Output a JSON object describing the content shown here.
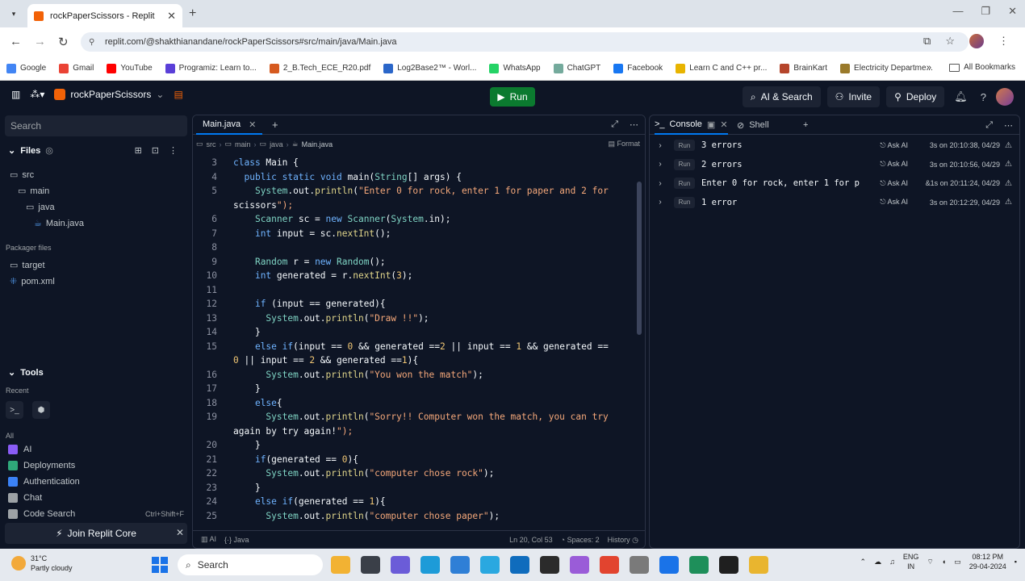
{
  "browser": {
    "tab_title": "rockPaperScissors - Replit",
    "url": "replit.com/@shakthianandane/rockPaperScissors#src/main/java/Main.java",
    "bookmarks": [
      {
        "label": "Google",
        "color": "#4285f4"
      },
      {
        "label": "Gmail",
        "color": "#ea4335"
      },
      {
        "label": "YouTube",
        "color": "#ff0000"
      },
      {
        "label": "Programiz: Learn to...",
        "color": "#5a3fd8"
      },
      {
        "label": "2_B.Tech_ECE_R20.pdf",
        "color": "#d65a1f"
      },
      {
        "label": "Log2Base2™ - Worl...",
        "color": "#2a66c9"
      },
      {
        "label": "WhatsApp",
        "color": "#25d366"
      },
      {
        "label": "ChatGPT",
        "color": "#74aa9c"
      },
      {
        "label": "Facebook",
        "color": "#1877f2"
      },
      {
        "label": "Learn C and C++ pr...",
        "color": "#e8b400"
      },
      {
        "label": "BrainKart",
        "color": "#b5452b"
      },
      {
        "label": "Electricity Departme...",
        "color": "#9a7a2b"
      }
    ],
    "all_bookmarks": "All Bookmarks"
  },
  "replit": {
    "repl_name": "rockPaperScissors",
    "run_label": "Run",
    "ai_search": "AI & Search",
    "invite": "Invite",
    "deploy": "Deploy"
  },
  "sidebar": {
    "search_placeholder": "Search",
    "files_label": "Files",
    "tree": [
      {
        "label": "src",
        "indent": 0,
        "kind": "folder"
      },
      {
        "label": "main",
        "indent": 1,
        "kind": "folder"
      },
      {
        "label": "java",
        "indent": 2,
        "kind": "folder"
      },
      {
        "label": "Main.java",
        "indent": 3,
        "kind": "file"
      }
    ],
    "packager_label": "Packager files",
    "packager": [
      {
        "label": "target",
        "kind": "folder"
      },
      {
        "label": "pom.xml",
        "kind": "file"
      }
    ],
    "tools_label": "Tools",
    "recent_label": "Recent",
    "all_label": "All",
    "tools": [
      {
        "label": "AI",
        "color": "#8a5cf6"
      },
      {
        "label": "Deployments",
        "color": "#2fa87a"
      },
      {
        "label": "Authentication",
        "color": "#3b82f6"
      },
      {
        "label": "Chat",
        "color": "#9da2a6"
      },
      {
        "label": "Code Search",
        "color": "#9da2a6"
      }
    ],
    "code_search_shortcut": "Ctrl+Shift+F",
    "join_core": "Join Replit Core"
  },
  "editor": {
    "tab_label": "Main.java",
    "breadcrumbs": [
      "src",
      "main",
      "java",
      "Main.java"
    ],
    "format_label": "Format",
    "lines": [
      {
        "n": "3",
        "t": "class Main {"
      },
      {
        "n": "4",
        "t": "  public static void main(String[] args) {"
      },
      {
        "n": "5",
        "t": "    System.out.println(\"Enter 0 for rock, enter 1 for paper and 2 for"
      },
      {
        "n": "",
        "t": "scissors\");"
      },
      {
        "n": "6",
        "t": "    Scanner sc = new Scanner(System.in);"
      },
      {
        "n": "7",
        "t": "    int input = sc.nextInt();"
      },
      {
        "n": "8",
        "t": ""
      },
      {
        "n": "9",
        "t": "    Random r = new Random();"
      },
      {
        "n": "10",
        "t": "    int generated = r.nextInt(3);"
      },
      {
        "n": "11",
        "t": ""
      },
      {
        "n": "12",
        "t": "    if (input == generated){"
      },
      {
        "n": "13",
        "t": "      System.out.println(\"Draw !!\");"
      },
      {
        "n": "14",
        "t": "    }"
      },
      {
        "n": "15",
        "t": "    else if(input == 0 && generated ==2 || input == 1 && generated =="
      },
      {
        "n": "",
        "t": "0 || input == 2 && generated ==1){"
      },
      {
        "n": "16",
        "t": "      System.out.println(\"You won the match\");"
      },
      {
        "n": "17",
        "t": "    }"
      },
      {
        "n": "18",
        "t": "    else{"
      },
      {
        "n": "19",
        "t": "      System.out.println(\"Sorry!! Computer won the match, you can try"
      },
      {
        "n": "",
        "t": "again by try again!\");"
      },
      {
        "n": "20",
        "t": "    }"
      },
      {
        "n": "21",
        "t": "    if(generated == 0){"
      },
      {
        "n": "22",
        "t": "      System.out.println(\"computer chose rock\");"
      },
      {
        "n": "23",
        "t": "    }"
      },
      {
        "n": "24",
        "t": "    else if(generated == 1){"
      },
      {
        "n": "25",
        "t": "      System.out.println(\"computer chose paper\");"
      }
    ],
    "status_ai": "AI",
    "status_lang": "Java",
    "cursor_pos": "Ln 20, Col 53",
    "spaces": "Spaces: 2",
    "history": "History"
  },
  "console": {
    "console_tab": "Console",
    "shell_tab": "Shell",
    "run_label": "Run",
    "ask_ai": "Ask AI",
    "rows": [
      {
        "msg": "3 errors",
        "time": "3s on 20:10:38, 04/29"
      },
      {
        "msg": "2 errors",
        "time": "3s on 20:10:56, 04/29"
      },
      {
        "msg": "Enter 0 for rock, enter 1 for p...",
        "time": "&1s on 20:11:24, 04/29"
      },
      {
        "msg": "1 error",
        "time": "3s on 20:12:29, 04/29"
      }
    ]
  },
  "taskbar": {
    "temp": "31°C",
    "weather": "Partly cloudy",
    "search": "Search",
    "lang1": "ENG",
    "lang2": "IN",
    "time": "08:12 PM",
    "date": "29-04-2024",
    "apps": [
      "#f2b233",
      "#3a3f48",
      "#6b5cd8",
      "#1d9bd8",
      "#2f7fd6",
      "#2aa8e0",
      "#0f6cbd",
      "#2b2b2b",
      "#9a5cd8",
      "#e2442f",
      "#7a7a7a",
      "#1a73e8",
      "#1e8f5a",
      "#1f1f1f",
      "#e9b52f"
    ]
  }
}
